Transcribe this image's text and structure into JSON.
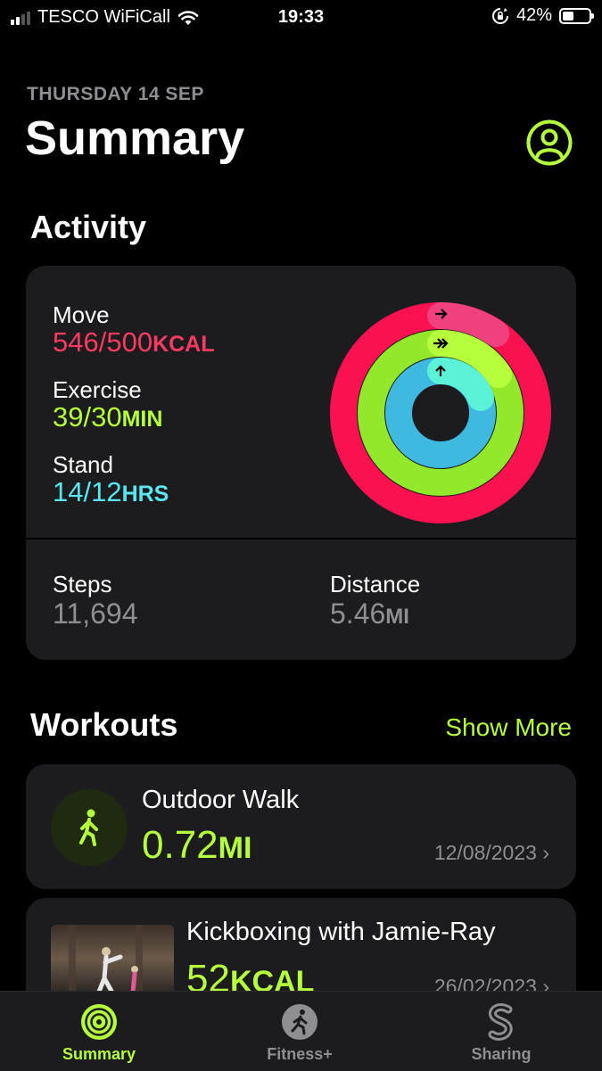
{
  "status_bar": {
    "carrier": "TESCO WiFiCall",
    "time": "19:33",
    "battery": "42%",
    "battery_level": 0.42
  },
  "header": {
    "date": "THURSDAY 14 SEP",
    "title": "Summary"
  },
  "activity": {
    "section_title": "Activity",
    "move": {
      "label": "Move",
      "value": "546/500",
      "unit": "KCAL",
      "color": "#fa3a5f"
    },
    "exercise": {
      "label": "Exercise",
      "value": "39/30",
      "unit": "MIN",
      "color": "#b5ff3c"
    },
    "stand": {
      "label": "Stand",
      "value": "14/12",
      "unit": "HRS",
      "color": "#58e6f0"
    },
    "steps": {
      "label": "Steps",
      "value": "11,694"
    },
    "distance": {
      "label": "Distance",
      "value": "5.46",
      "unit": "MI"
    }
  },
  "workouts": {
    "section_title": "Workouts",
    "show_more": "Show More",
    "items": [
      {
        "name": "Outdoor Walk",
        "value": "0.72",
        "unit": "MI",
        "date": "12/08/2023"
      },
      {
        "name": "Kickboxing with Jamie-Ray",
        "value": "52",
        "unit": "KCAL",
        "date": "26/02/2023"
      }
    ]
  },
  "tabbar": {
    "items": [
      {
        "label": "Summary",
        "active": true
      },
      {
        "label": "Fitness+",
        "active": false
      },
      {
        "label": "Sharing",
        "active": false
      }
    ]
  },
  "colors": {
    "accent": "#b5ff3c",
    "card": "#1c1c1e",
    "secondary_text": "#8e8e93"
  }
}
